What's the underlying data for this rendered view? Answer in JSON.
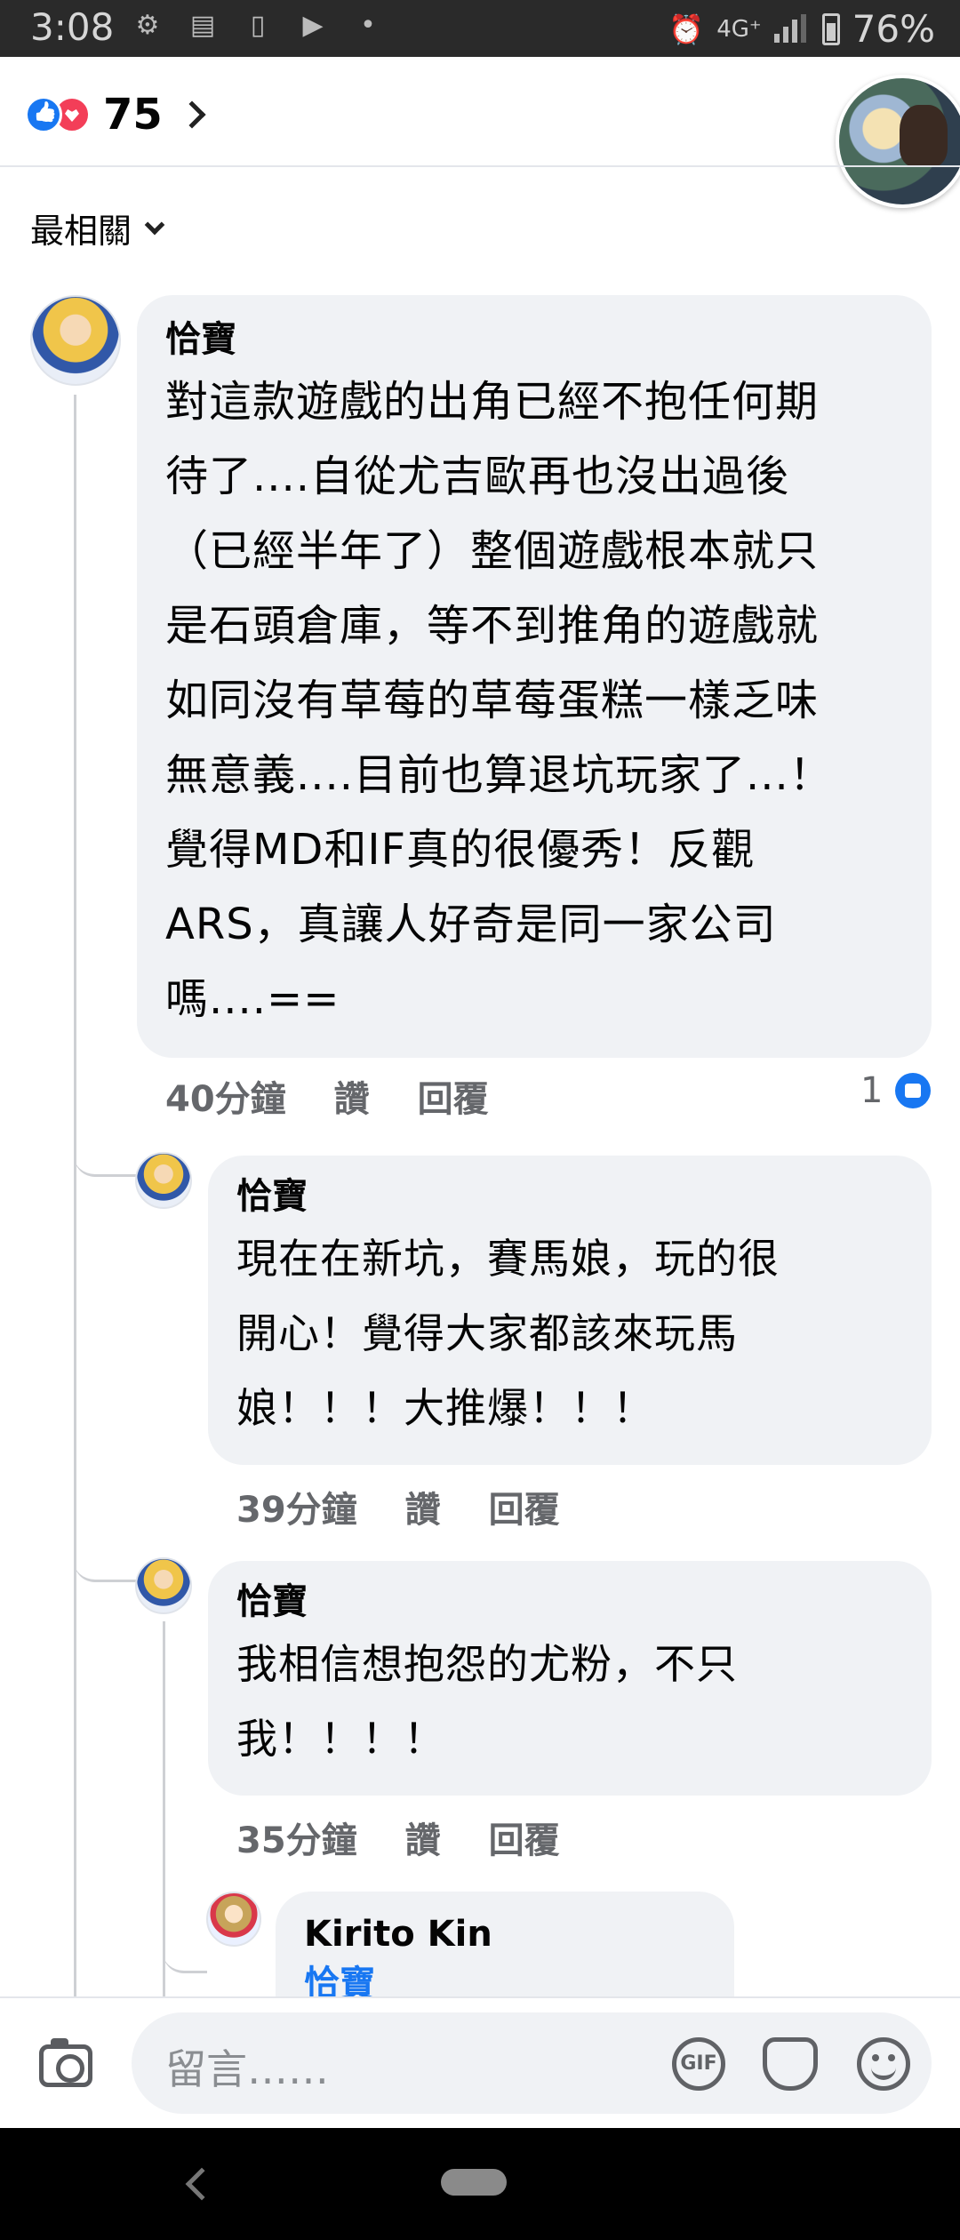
{
  "status_bar": {
    "time": "3:08",
    "network": "4G⁺",
    "battery": "76%"
  },
  "header": {
    "reaction_count": "75"
  },
  "sort": {
    "label": "最相關"
  },
  "comments": [
    {
      "author": "恰寶",
      "lines": [
        "對這款遊戲的出角已經不抱任何期",
        "待了....自從尤吉歐再也沒出過後",
        "（已經半年了）整個遊戲根本就只",
        "是石頭倉庫，等不到推角的遊戲就",
        "如同沒有草莓的草莓蛋糕一樣乏味",
        "無意義....目前也算退坑玩家了...！",
        "覺得MD和IF真的很優秀！反觀",
        "ARS，真讓人好奇是同一家公司",
        "嗎....=="
      ],
      "time": "40分鐘",
      "like": "讚",
      "reply": "回覆",
      "likes": "1"
    },
    {
      "author": "恰寶",
      "lines": [
        "現在在新坑，賽馬娘，玩的很",
        "開心！覺得大家都該來玩馬",
        "娘！！！大推爆！！！"
      ],
      "time": "39分鐘",
      "like": "讚",
      "reply": "回覆"
    },
    {
      "author": "恰寶",
      "lines": [
        "我相信想抱怨的尤粉，不只",
        "我！！！！"
      ],
      "time": "35分鐘",
      "like": "讚",
      "reply": "回覆"
    },
    {
      "author": "Kirito Kin",
      "mention": "恰寶"
    }
  ],
  "compose": {
    "placeholder": "留言……",
    "gif_label": "GIF"
  }
}
